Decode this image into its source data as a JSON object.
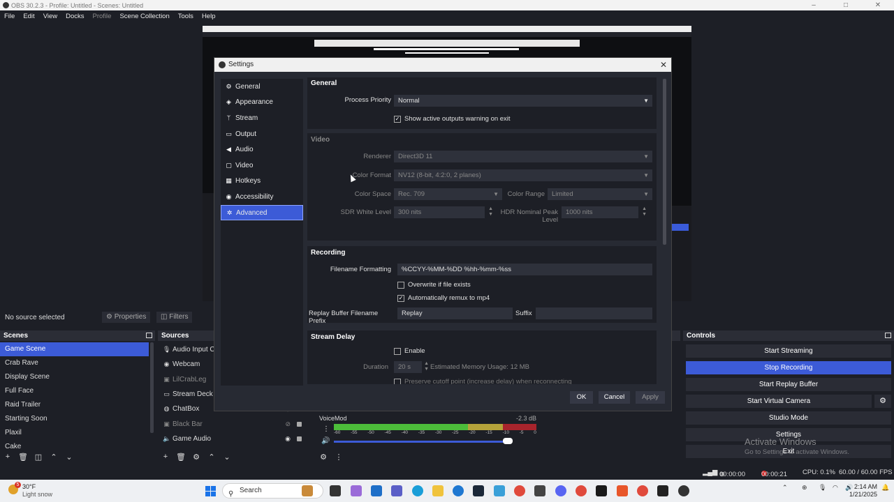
{
  "window": {
    "title": "OBS 30.2.3 - Profile: Untitled - Scenes: Untitled"
  },
  "menu": [
    "File",
    "Edit",
    "View",
    "Docks",
    "Profile",
    "Scene Collection",
    "Tools",
    "Help"
  ],
  "source_bar": {
    "no_source": "No source selected",
    "properties": "Properties",
    "filters": "Filters"
  },
  "docks": {
    "scenes": "Scenes",
    "sources": "Sources",
    "controls": "Controls"
  },
  "scenes": [
    "Game Scene",
    "Crab Rave",
    "Display Scene",
    "Full Face",
    "Raid Trailer",
    "Starting Soon",
    "Plaxil",
    "Cake"
  ],
  "sources": [
    {
      "name": "Audio Input Capture",
      "icon": "microphone-icon"
    },
    {
      "name": "Webcam",
      "icon": "camera-icon"
    },
    {
      "name": "LilCrabLeg",
      "icon": "image-icon"
    },
    {
      "name": "Stream Deck",
      "icon": "monitor-icon"
    },
    {
      "name": "ChatBox",
      "icon": "browser-icon"
    },
    {
      "name": "Black Bar",
      "icon": "image-icon"
    },
    {
      "name": "Game Audio",
      "icon": "speaker-icon"
    }
  ],
  "mixer": {
    "name": "VoiceMod",
    "db": "-2.3 dB",
    "ticks": [
      "-60",
      "-55",
      "-50",
      "-45",
      "-40",
      "-35",
      "-30",
      "-25",
      "-20",
      "-15",
      "-10",
      "-5",
      "0"
    ]
  },
  "controls": {
    "start_streaming": "Start Streaming",
    "stop_recording": "Stop Recording",
    "start_replay": "Start Replay Buffer",
    "start_virtual_camera": "Start Virtual Camera",
    "studio_mode": "Studio Mode",
    "settings": "Settings",
    "exit": "Exit"
  },
  "watermark": {
    "line1": "Activate Windows",
    "line2": "Go to Settings to activate Windows."
  },
  "status": {
    "stream_time": "00:00:00",
    "rec_time": "00:00:21",
    "cpu": "CPU: 0.1%",
    "fps": "60.00 / 60.00 FPS"
  },
  "taskbar": {
    "temp": "30°F",
    "weather": "Light snow",
    "weather_badge": "5",
    "search": "Search",
    "time": "2:14 AM",
    "date": "1/21/2025"
  },
  "settings": {
    "title": "Settings",
    "nav": [
      {
        "label": "General",
        "icon": "gear-icon"
      },
      {
        "label": "Appearance",
        "icon": "palette-icon"
      },
      {
        "label": "Stream",
        "icon": "antenna-icon"
      },
      {
        "label": "Output",
        "icon": "output-icon"
      },
      {
        "label": "Audio",
        "icon": "speaker-icon"
      },
      {
        "label": "Video",
        "icon": "monitor-icon"
      },
      {
        "label": "Hotkeys",
        "icon": "keyboard-icon"
      },
      {
        "label": "Accessibility",
        "icon": "accessibility-icon"
      },
      {
        "label": "Advanced",
        "icon": "wrench-icon"
      }
    ],
    "general": {
      "title": "General",
      "process_priority_label": "Process Priority",
      "process_priority": "Normal",
      "show_warning": "Show active outputs warning on exit"
    },
    "video": {
      "title": "Video",
      "renderer_label": "Renderer",
      "renderer": "Direct3D 11",
      "color_format_label": "Color Format",
      "color_format": "NV12 (8-bit, 4:2:0, 2 planes)",
      "color_space_label": "Color Space",
      "color_space": "Rec. 709",
      "color_range_label": "Color Range",
      "color_range": "Limited",
      "sdr_label": "SDR White Level",
      "sdr": "300 nits",
      "hdr_label": "HDR Nominal Peak Level",
      "hdr": "1000 nits"
    },
    "recording": {
      "title": "Recording",
      "filename_label": "Filename Formatting",
      "filename": "%CCYY-%MM-%DD %hh-%mm-%ss",
      "overwrite": "Overwrite if file exists",
      "remux": "Automatically remux to mp4",
      "replay_prefix_label": "Replay Buffer Filename Prefix",
      "replay_prefix": "Replay",
      "suffix_label": "Suffix",
      "suffix": ""
    },
    "stream_delay": {
      "title": "Stream Delay",
      "enable": "Enable",
      "duration_label": "Duration",
      "duration": "20 s",
      "memory": "Estimated Memory Usage: 12 MB",
      "preserve": "Preserve cutoff point (increase delay) when reconnecting"
    },
    "buttons": {
      "ok": "OK",
      "cancel": "Cancel",
      "apply": "Apply"
    }
  }
}
